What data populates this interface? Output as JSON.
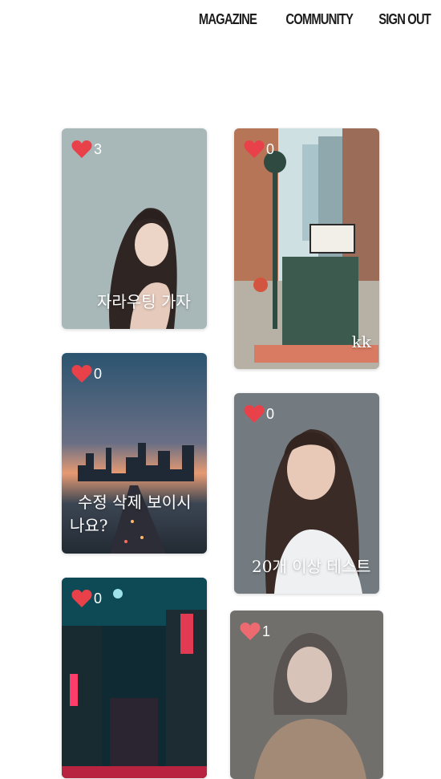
{
  "nav": {
    "items": [
      {
        "label": "MAGAZINE"
      },
      {
        "label": "COMMUNITY"
      },
      {
        "label": "SIGN OUT"
      }
    ]
  },
  "posts": [
    {
      "likes": "3",
      "title": "자라우팅 가자"
    },
    {
      "likes": "0",
      "title": "kk"
    },
    {
      "likes": "0",
      "title": "수정 삭제 보이시나요?"
    },
    {
      "likes": "0",
      "title": "20개 이상 테스트"
    },
    {
      "likes": "0",
      "title": ""
    },
    {
      "likes": "1",
      "title": ""
    }
  ],
  "colors": {
    "heart": "#e8414a",
    "nav_text": "#1c1c1c"
  },
  "icons": {
    "like": "heart-icon"
  }
}
